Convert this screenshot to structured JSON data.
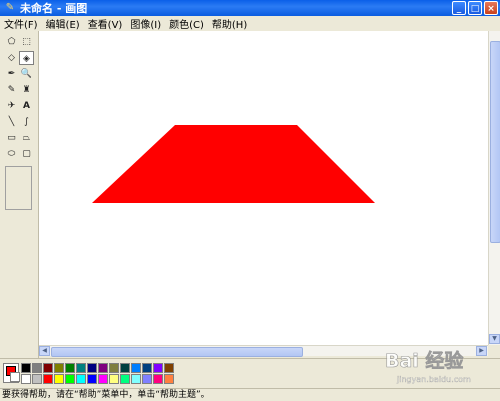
{
  "window": {
    "title": "未命名 - 画图",
    "minimize_label": "_",
    "maximize_label": "□",
    "close_label": "×"
  },
  "menu": {
    "items": [
      {
        "label": "文件(F)"
      },
      {
        "label": "编辑(E)"
      },
      {
        "label": "查看(V)"
      },
      {
        "label": "图像(I)"
      },
      {
        "label": "颜色(C)"
      },
      {
        "label": "帮助(H)"
      }
    ]
  },
  "tools": [
    {
      "name": "free-form-select-icon",
      "glyph": "⬠"
    },
    {
      "name": "select-icon",
      "glyph": "⬚"
    },
    {
      "name": "eraser-icon",
      "glyph": "◇"
    },
    {
      "name": "fill-icon",
      "glyph": "◈",
      "active": true
    },
    {
      "name": "pick-color-icon",
      "glyph": "✒"
    },
    {
      "name": "magnifier-icon",
      "glyph": "🔍"
    },
    {
      "name": "pencil-icon",
      "glyph": "✎"
    },
    {
      "name": "brush-icon",
      "glyph": "♜"
    },
    {
      "name": "airbrush-icon",
      "glyph": "✈"
    },
    {
      "name": "text-icon",
      "glyph": "A"
    },
    {
      "name": "line-icon",
      "glyph": "╲"
    },
    {
      "name": "curve-icon",
      "glyph": "∫"
    },
    {
      "name": "rectangle-icon",
      "glyph": "▭"
    },
    {
      "name": "polygon-icon",
      "glyph": "⏢"
    },
    {
      "name": "ellipse-icon",
      "glyph": "⬭"
    },
    {
      "name": "rounded-rectangle-icon",
      "glyph": "▢"
    }
  ],
  "canvas": {
    "shape_color": "#ff0000",
    "shape": "trapezoid"
  },
  "colors": {
    "foreground": "#ff0000",
    "background": "#ffffff",
    "palette": [
      "#000000",
      "#808080",
      "#800000",
      "#808000",
      "#008000",
      "#008080",
      "#000080",
      "#800080",
      "#808040",
      "#004040",
      "#0080ff",
      "#004080",
      "#8000ff",
      "#804000",
      "#ffffff",
      "#c0c0c0",
      "#ff0000",
      "#ffff00",
      "#00ff00",
      "#00ffff",
      "#0000ff",
      "#ff00ff",
      "#ffff80",
      "#00ff80",
      "#80ffff",
      "#8080ff",
      "#ff0080",
      "#ff8040"
    ]
  },
  "status": {
    "text": "要获得帮助，请在“帮助”菜单中，单击“帮助主题”。"
  },
  "watermark": {
    "text": "Bai 经验",
    "sub": "jingyan.baidu.com"
  }
}
